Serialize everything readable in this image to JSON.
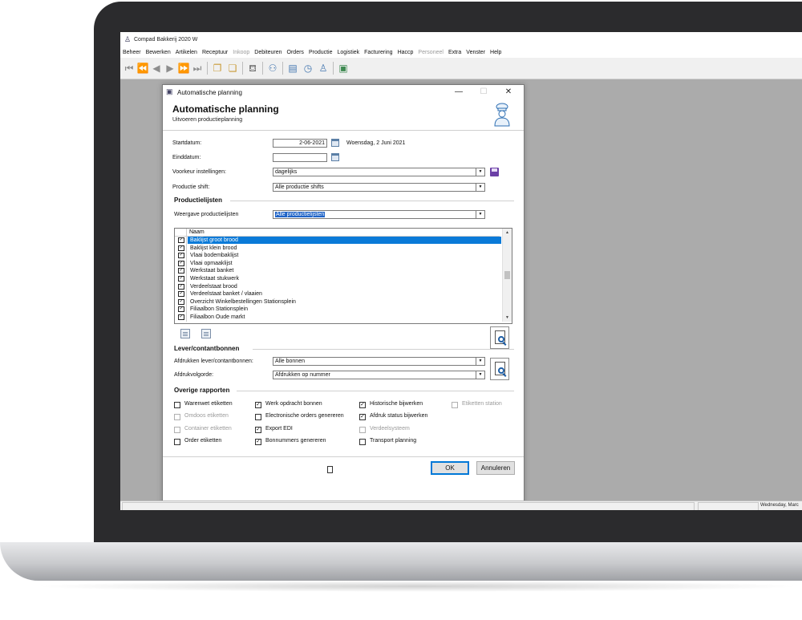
{
  "app": {
    "title": "Compad Bakkerij 2020 W",
    "menu": [
      {
        "label": "Beheer",
        "disabled": false
      },
      {
        "label": "Bewerken",
        "disabled": false
      },
      {
        "label": "Artikelen",
        "disabled": false
      },
      {
        "label": "Receptuur",
        "disabled": false
      },
      {
        "label": "Inkoop",
        "disabled": true
      },
      {
        "label": "Debiteuren",
        "disabled": false
      },
      {
        "label": "Orders",
        "disabled": false
      },
      {
        "label": "Productie",
        "disabled": false
      },
      {
        "label": "Logistiek",
        "disabled": false
      },
      {
        "label": "Facturering",
        "disabled": false
      },
      {
        "label": "Haccp",
        "disabled": false
      },
      {
        "label": "Personeel",
        "disabled": true
      },
      {
        "label": "Extra",
        "disabled": false
      },
      {
        "label": "Venster",
        "disabled": false
      },
      {
        "label": "Help",
        "disabled": false
      }
    ],
    "status_date": "Wednesday, Marc"
  },
  "dialog": {
    "window_title": "Automatische planning",
    "title": "Automatische planning",
    "subtitle": "Uitvoeren productieplanning",
    "startdatum": {
      "label": "Startdatum:",
      "value": "2-06-2021",
      "long": "Woensdag, 2 Juni 2021"
    },
    "einddatum": {
      "label": "Einddatum:",
      "value": ""
    },
    "voorkeur": {
      "label": "Voorkeur instellingen:",
      "value": "dagelijks"
    },
    "shift": {
      "label": "Productie shift:",
      "value": "Alle productie shifts"
    },
    "productielijsten": {
      "section": "Productielijsten",
      "weergave_label": "Weergave productielijsten",
      "weergave_value": "Alle productielijsten",
      "column": "Naam",
      "items": [
        {
          "name": "Baklijst groot brood",
          "checked": true,
          "selected": true
        },
        {
          "name": "Baklijst klein brood",
          "checked": true,
          "selected": false
        },
        {
          "name": "Vlaai bodembaklijst",
          "checked": true,
          "selected": false
        },
        {
          "name": "Vlaai opmaaklijst",
          "checked": true,
          "selected": false
        },
        {
          "name": "Werkstaat banket",
          "checked": true,
          "selected": false
        },
        {
          "name": "Werkstaat stukwerk",
          "checked": true,
          "selected": false
        },
        {
          "name": "Verdeelstaat brood",
          "checked": true,
          "selected": false
        },
        {
          "name": "Verdeelstaat banket / vlaaien",
          "checked": true,
          "selected": false
        },
        {
          "name": "Overzicht Winkelbestellingen Stationsplein",
          "checked": true,
          "selected": false
        },
        {
          "name": "Filiaalbon Stationsplein",
          "checked": true,
          "selected": false
        },
        {
          "name": "Filiaalbon Oude markt",
          "checked": true,
          "selected": false
        }
      ]
    },
    "lever": {
      "section": "Lever/contantbonnen",
      "afdrukken_label": "Afdrukken lever/contantbonnen:",
      "afdrukken_value": "Alle bonnen",
      "volgorde_label": "Afdrukvolgorde:",
      "volgorde_value": "Afdrukken op nummer"
    },
    "overige": {
      "section": "Overige rapporten",
      "options": [
        {
          "label": "Warenwet etiketten",
          "checked": false,
          "disabled": false
        },
        {
          "label": "Omdoos etiketten",
          "checked": false,
          "disabled": true
        },
        {
          "label": "Container etiketten",
          "checked": false,
          "disabled": true
        },
        {
          "label": "Order etiketten",
          "checked": false,
          "disabled": false
        },
        {
          "label": "Werk opdracht bonnen",
          "checked": true,
          "disabled": false
        },
        {
          "label": "Electronische orders genereren",
          "checked": false,
          "disabled": false
        },
        {
          "label": "Export EDI",
          "checked": true,
          "disabled": false
        },
        {
          "label": "Bonnummers genereren",
          "checked": true,
          "disabled": false
        },
        {
          "label": "Historische bijwerken",
          "checked": true,
          "disabled": false
        },
        {
          "label": "Afdruk status bijwerken",
          "checked": true,
          "disabled": false
        },
        {
          "label": "Verdeelsysteem",
          "checked": false,
          "disabled": true
        },
        {
          "label": "Transport planning",
          "checked": false,
          "disabled": false
        },
        {
          "label": "Etiketten station",
          "checked": false,
          "disabled": true
        }
      ]
    },
    "buttons": {
      "ok": "OK",
      "cancel": "Annuleren"
    }
  },
  "colors": {
    "selection": "#0a7ad8",
    "accent": "#0078d7",
    "workspace": "#ababab"
  }
}
